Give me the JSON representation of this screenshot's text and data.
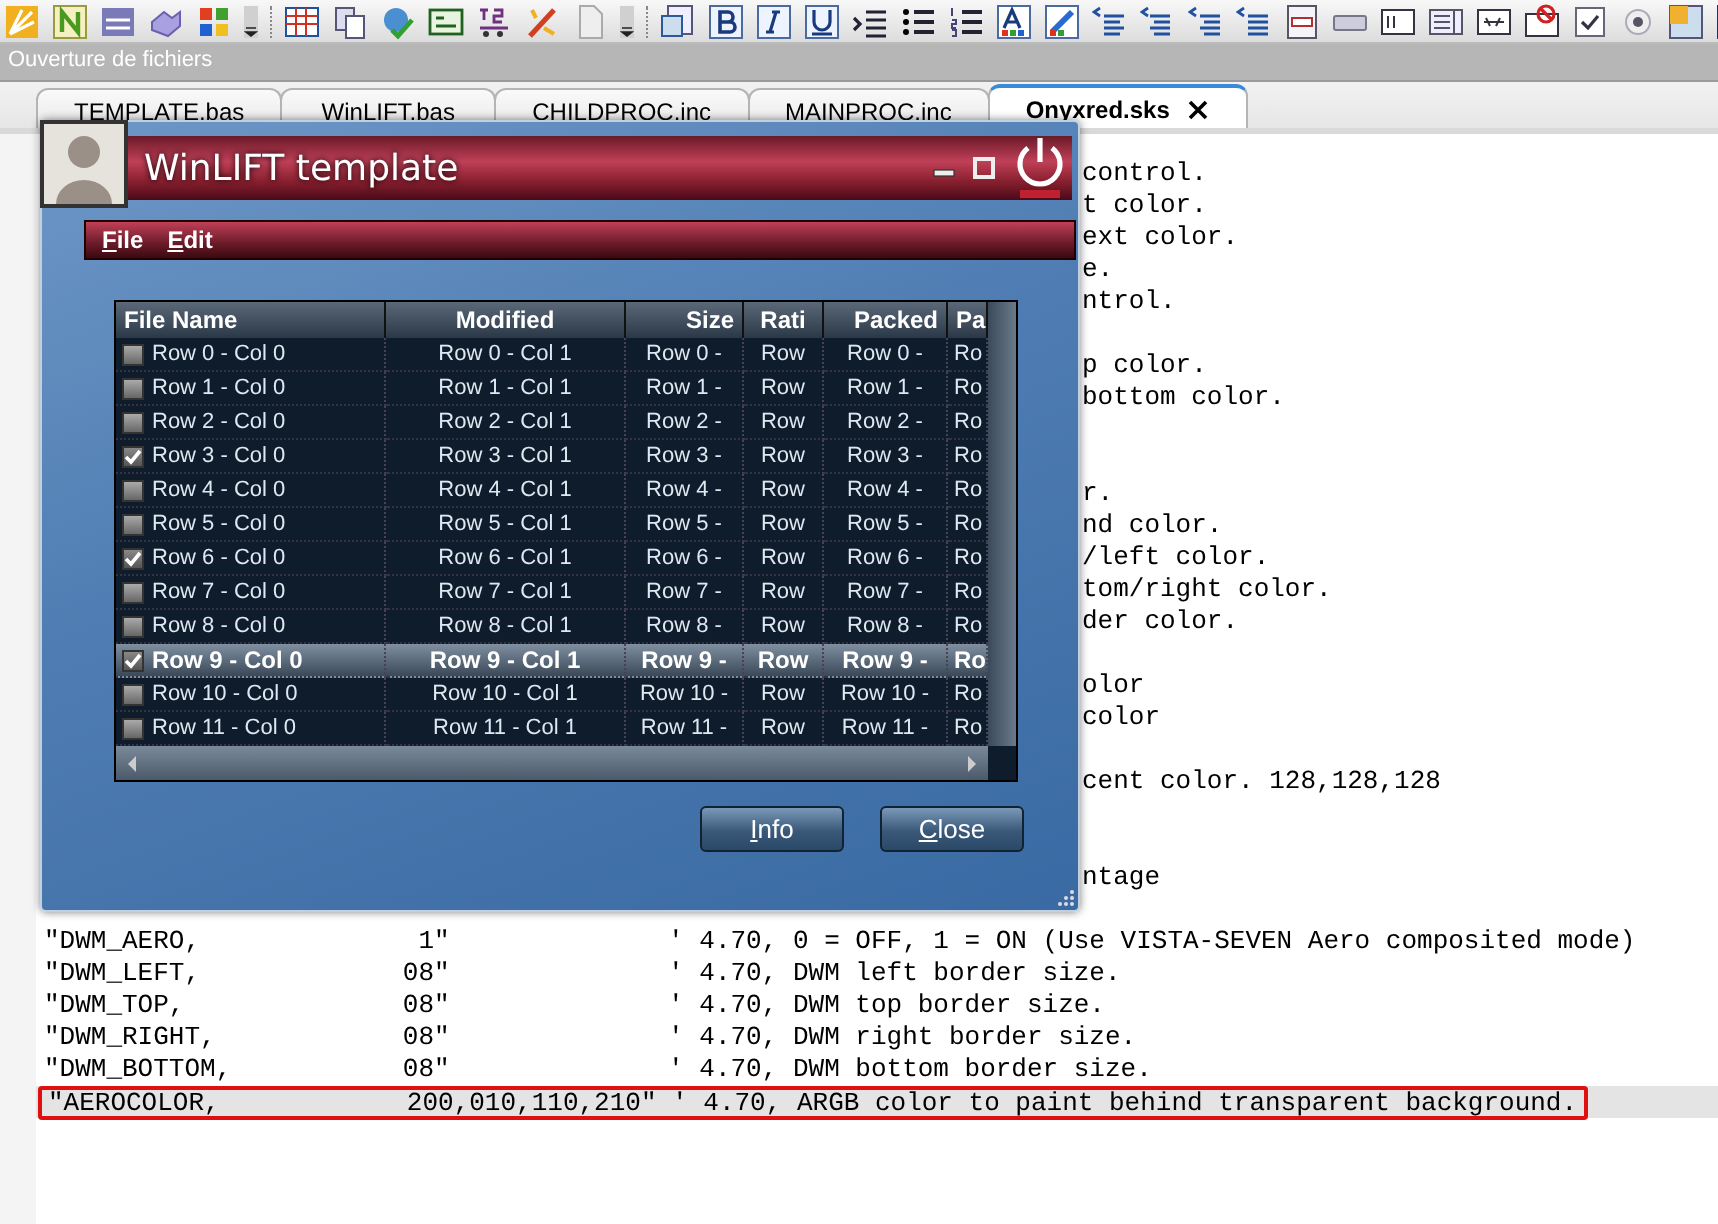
{
  "panel_title": "Ouverture de fichiers",
  "tabs": [
    {
      "label": "TEMPLATE.bas",
      "selected": false
    },
    {
      "label": "WinLIFT.bas",
      "selected": false
    },
    {
      "label": "CHILDPROC.inc",
      "selected": false
    },
    {
      "label": "MAINPROC.inc",
      "selected": false
    },
    {
      "label": "Onyxred.sks",
      "selected": true
    }
  ],
  "editor": {
    "lines_beside_window": [
      {
        "kind": "text",
        "text": "control."
      },
      {
        "kind": "text",
        "text": "t color."
      },
      {
        "kind": "text",
        "text": "ext color."
      },
      {
        "kind": "text",
        "text": "e."
      },
      {
        "kind": "text",
        "text": "ntrol."
      },
      {
        "kind": "blank"
      },
      {
        "kind": "text",
        "text": "p color."
      },
      {
        "kind": "text",
        "text": "bottom color."
      },
      {
        "kind": "blank"
      },
      {
        "kind": "blank"
      },
      {
        "kind": "text",
        "text": "r."
      },
      {
        "kind": "text",
        "text": "nd color."
      },
      {
        "kind": "text",
        "text": "/left color."
      },
      {
        "kind": "text",
        "text": "tom/right color."
      },
      {
        "kind": "text",
        "text": "der color."
      },
      {
        "kind": "blank"
      },
      {
        "kind": "text",
        "text": "olor"
      },
      {
        "kind": "text",
        "text": "color"
      },
      {
        "kind": "blank"
      },
      {
        "kind": "text",
        "text": "cent color. 128,128,128"
      },
      {
        "kind": "blank"
      },
      {
        "kind": "blank"
      },
      {
        "kind": "text",
        "text": "ntage"
      },
      {
        "kind": "blank"
      }
    ],
    "lines": [
      {
        "text": "\"DWM_AERO,              1\"              ' 4.70, 0 = OFF, 1 = ON (Use VISTA-SEVEN Aero composited mode)",
        "highlighted": false
      },
      {
        "text": "\"DWM_LEFT,             08\"              ' 4.70, DWM left border size.",
        "highlighted": false
      },
      {
        "text": "\"DWM_TOP,              08\"              ' 4.70, DWM top border size.",
        "highlighted": false
      },
      {
        "text": "\"DWM_RIGHT,            08\"              ' 4.70, DWM right border size.",
        "highlighted": false
      },
      {
        "text": "\"DWM_BOTTOM,           08\"              ' 4.70, DWM bottom border size.",
        "highlighted": false
      },
      {
        "text": "\"AEROCOLOR,            200,010,110,210\" ' 4.70, ARGB color to paint behind transparent background.",
        "highlighted": true
      }
    ]
  },
  "window": {
    "title": "WinLIFT template",
    "menu": [
      {
        "label": "File"
      },
      {
        "label": "Edit"
      }
    ],
    "grid": {
      "columns": [
        "File Name",
        "Modified",
        "Size",
        "Rati",
        "Packed",
        "Pa"
      ],
      "rows": [
        {
          "cells": [
            "Row 0 - Col 0",
            "Row 0 - Col 1",
            "Row 0 -",
            "Row",
            "Row 0 -",
            "Ro"
          ],
          "checked": false,
          "selected": false
        },
        {
          "cells": [
            "Row 1 - Col 0",
            "Row 1 - Col 1",
            "Row 1 -",
            "Row",
            "Row 1 -",
            "Ro"
          ],
          "checked": false,
          "selected": false
        },
        {
          "cells": [
            "Row 2 - Col 0",
            "Row 2 - Col 1",
            "Row 2 -",
            "Row",
            "Row 2 -",
            "Ro"
          ],
          "checked": false,
          "selected": false
        },
        {
          "cells": [
            "Row 3 - Col 0",
            "Row 3 - Col 1",
            "Row 3 -",
            "Row",
            "Row 3 -",
            "Ro"
          ],
          "checked": true,
          "selected": false
        },
        {
          "cells": [
            "Row 4 - Col 0",
            "Row 4 - Col 1",
            "Row 4 -",
            "Row",
            "Row 4 -",
            "Ro"
          ],
          "checked": false,
          "selected": false
        },
        {
          "cells": [
            "Row 5 - Col 0",
            "Row 5 - Col 1",
            "Row 5 -",
            "Row",
            "Row 5 -",
            "Ro"
          ],
          "checked": false,
          "selected": false
        },
        {
          "cells": [
            "Row 6 - Col 0",
            "Row 6 - Col 1",
            "Row 6 -",
            "Row",
            "Row 6 -",
            "Ro"
          ],
          "checked": true,
          "selected": false
        },
        {
          "cells": [
            "Row 7 - Col 0",
            "Row 7 - Col 1",
            "Row 7 -",
            "Row",
            "Row 7 -",
            "Ro"
          ],
          "checked": false,
          "selected": false
        },
        {
          "cells": [
            "Row 8 - Col 0",
            "Row 8 - Col 1",
            "Row 8 -",
            "Row",
            "Row 8 -",
            "Ro"
          ],
          "checked": false,
          "selected": false
        },
        {
          "cells": [
            "Row 9 - Col 0",
            "Row 9 - Col 1",
            "Row 9 -",
            "Row",
            "Row 9 -",
            "Ro"
          ],
          "checked": true,
          "selected": true
        },
        {
          "cells": [
            "Row 10 - Col 0",
            "Row 10 - Col 1",
            "Row 10 -",
            "Row",
            "Row 10 -",
            "Ro"
          ],
          "checked": false,
          "selected": false
        },
        {
          "cells": [
            "Row 11 - Col 0",
            "Row 11 - Col 1",
            "Row 11 -",
            "Row",
            "Row 11 -",
            "Ro"
          ],
          "checked": false,
          "selected": false
        }
      ]
    },
    "buttons": [
      "Info",
      "Close"
    ]
  }
}
